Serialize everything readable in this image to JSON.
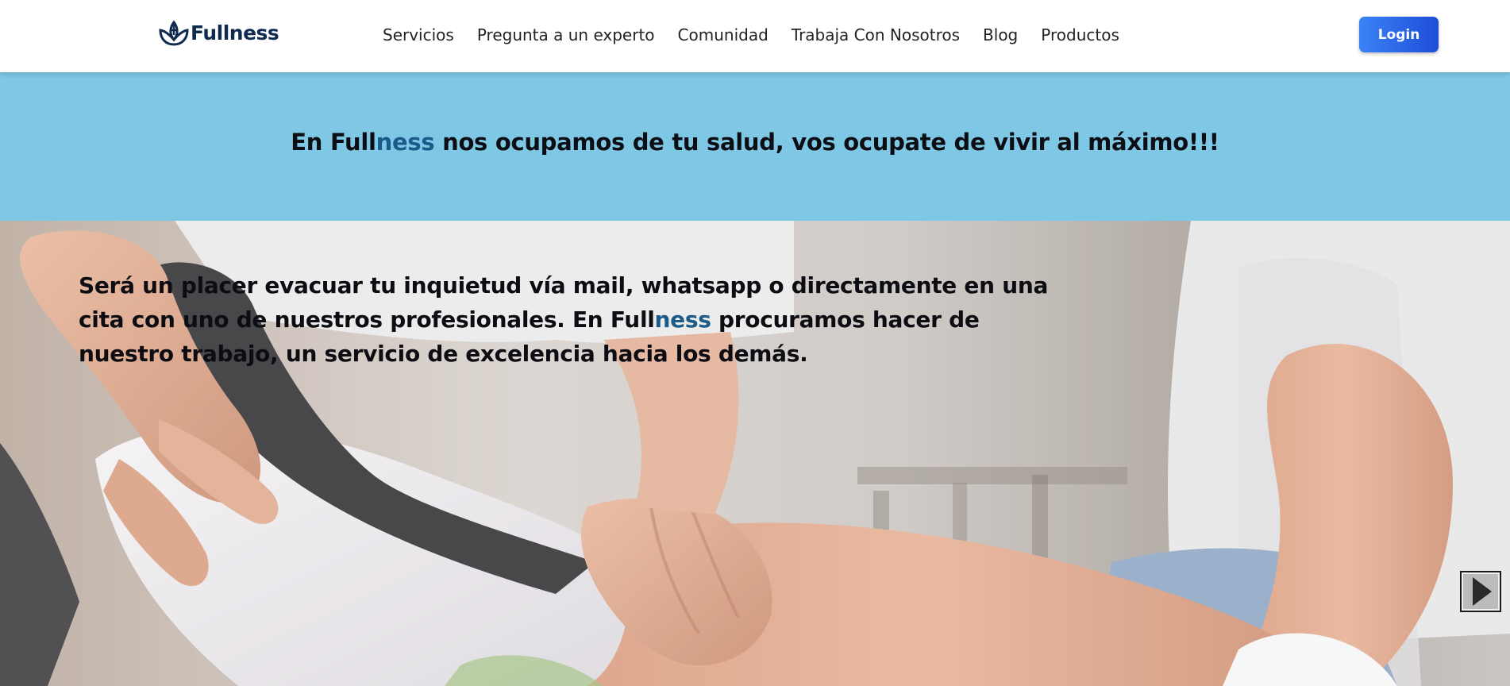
{
  "brand": {
    "name": "Fullness",
    "logo_icon": "lotus-person-icon"
  },
  "nav": {
    "items": [
      {
        "label": "Servicios"
      },
      {
        "label": "Pregunta a un experto"
      },
      {
        "label": "Comunidad"
      },
      {
        "label": "Trabaja Con Nosotros"
      },
      {
        "label": "Blog"
      },
      {
        "label": "Productos"
      }
    ]
  },
  "header": {
    "login_label": "Login"
  },
  "banner": {
    "prefix": "En Full",
    "accent": "ness",
    "suffix": " nos ocupamos de tu salud, vos ocupate de vivir al máximo!!!"
  },
  "hero": {
    "text_prefix": "Será un placer evacuar tu inquietud vía mail, whatsapp o directamente en una cita con uno de nuestros profesionales. En Full",
    "text_accent": "ness",
    "text_suffix": " procuramos hacer de nuestro trabajo, un servicio de excelencia hacia los demás.",
    "next_icon": "chevron-right-icon",
    "image_subject": "physiotherapist-treating-leg-photo"
  },
  "colors": {
    "brand_dark": "#0e2a4f",
    "brand_accent": "#1c5a8a",
    "banner_bg": "#7ec8e6",
    "login_start": "#3b82f6",
    "login_end": "#1d4ed8"
  }
}
